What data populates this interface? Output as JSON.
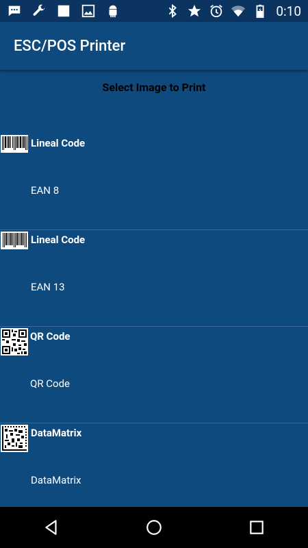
{
  "status_bar": {
    "time": "0:10",
    "left_icons": [
      "message-icon",
      "wrench-icon",
      "square-icon",
      "image-icon",
      "android-icon"
    ],
    "right_icons": [
      "bluetooth-icon",
      "star-icon",
      "alarm-icon",
      "wifi-icon",
      "battery-icon"
    ]
  },
  "app_bar": {
    "title": "ESC/POS Printer"
  },
  "heading": "Select Image to Print",
  "items": [
    {
      "title": "Lineal Code",
      "subtitle": "EAN 8",
      "thumb": "ean8-barcode-icon"
    },
    {
      "title": "Lineal Code",
      "subtitle": "EAN 13",
      "thumb": "ean13-barcode-icon"
    },
    {
      "title": "QR Code",
      "subtitle": "QR Code",
      "thumb": "qr-code-icon"
    },
    {
      "title": "DataMatrix",
      "subtitle": "DataMatrix",
      "thumb": "datamatrix-icon"
    }
  ],
  "nav": [
    "back-icon",
    "home-icon",
    "recents-icon"
  ],
  "colors": {
    "background": "#0f4a7e",
    "status_bar": "#0b3560",
    "nav_bar": "#000000"
  }
}
